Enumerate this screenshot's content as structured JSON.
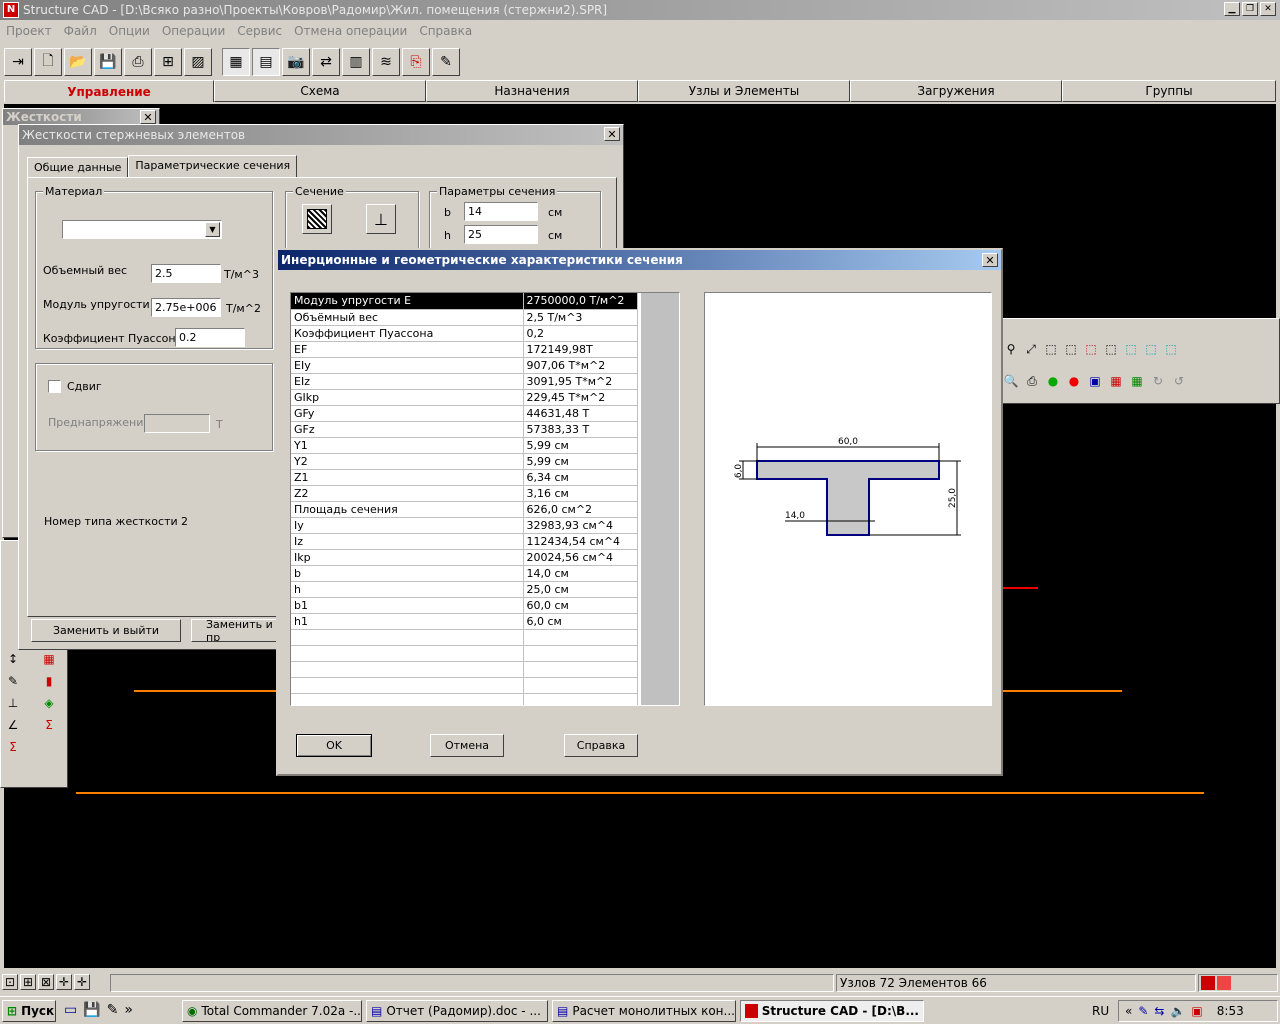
{
  "app": {
    "title": "Structure CAD  - [D:\\Всяко разно\\Проекты\\Ковров\\Радомир\\Жил. помещения (стержни2).SPR]",
    "menu": [
      "Проект",
      "Файл",
      "Опции",
      "Операции",
      "Сервис",
      "Отмена операции",
      "Справка"
    ],
    "tabs": [
      "Управление",
      "Схема",
      "Назначения",
      "Узлы и Элементы",
      "Загружения",
      "Группы"
    ],
    "active_tab_color": "#cc0000"
  },
  "stiffness_panel": {
    "title": "Жесткости"
  },
  "rod_dialog": {
    "title": "Жесткости стержневых элементов",
    "tabs": [
      "Общие данные",
      "Параметрические сечения"
    ],
    "material_group": "Материал",
    "volume_weight_label": "Объемный вес",
    "volume_weight_value": "2.5",
    "volume_weight_unit": "Т/м^3",
    "elastic_modulus_label": "Модуль упругости",
    "elastic_modulus_value": "2.75e+006",
    "elastic_modulus_unit": "Т/м^2",
    "poisson_label": "Коэффициент Пуассона",
    "poisson_value": "0.2",
    "shear_label": "Сдвиг",
    "prestress_label": "Преднапряжение",
    "prestress_unit": "Т",
    "stiffness_type_label": "Номер типа жесткости",
    "stiffness_type_value": "2",
    "section_group": "Сечение",
    "params_group": "Параметры сечения",
    "param_b_label": "b",
    "param_b_value": "14",
    "param_b_unit": "см",
    "param_h_label": "h",
    "param_h_value": "25",
    "param_h_unit": "см",
    "replace_exit_btn": "Заменить и выйти",
    "replace_btn": "Заменить и пр"
  },
  "inertia_dialog": {
    "title": "Инерционные и геометрические характеристики сечения",
    "rows": [
      [
        "Модуль упругости E",
        "2750000,0 Т/м^2"
      ],
      [
        "Объёмный вес",
        "2,5 Т/м^3"
      ],
      [
        "Коэффициент Пуассона",
        "0,2"
      ],
      [
        "EF",
        "172149,98Т"
      ],
      [
        "EIy",
        "907,06 Т*м^2"
      ],
      [
        "EIz",
        "3091,95 Т*м^2"
      ],
      [
        "GIkp",
        "229,45 Т*м^2"
      ],
      [
        "GFy",
        "44631,48 Т"
      ],
      [
        "GFz",
        "57383,33 Т"
      ],
      [
        "Y1",
        "5,99 см"
      ],
      [
        "Y2",
        "5,99 см"
      ],
      [
        "Z1",
        "6,34 см"
      ],
      [
        "Z2",
        "3,16 см"
      ],
      [
        "Площадь сечения",
        "626,0 см^2"
      ],
      [
        "Iy",
        "32983,93 см^4"
      ],
      [
        "Iz",
        "112434,54 см^4"
      ],
      [
        "Ikp",
        "20024,56 см^4"
      ],
      [
        "b",
        "14,0 см"
      ],
      [
        "h",
        "25,0 см"
      ],
      [
        "b1",
        "60,0 см"
      ],
      [
        "h1",
        "6,0 см"
      ]
    ],
    "empty_rows": 5,
    "drawing": {
      "dim_b1": "60,0",
      "dim_h1": "6,0",
      "dim_h": "25,0",
      "dim_b": "14,0"
    },
    "ok_btn": "OK",
    "cancel_btn": "Отмена",
    "help_btn": "Справка"
  },
  "status": {
    "text": "Узлов 72 Элементов 66"
  },
  "taskbar": {
    "start": "Пуск",
    "tasks": [
      "Total Commander 7.02a -...",
      "Отчет (Радомир).doc - ...",
      "Расчет монолитных кон...",
      "Structure CAD  - [D:\\B..."
    ],
    "lang": "RU",
    "clock": "8:53"
  }
}
